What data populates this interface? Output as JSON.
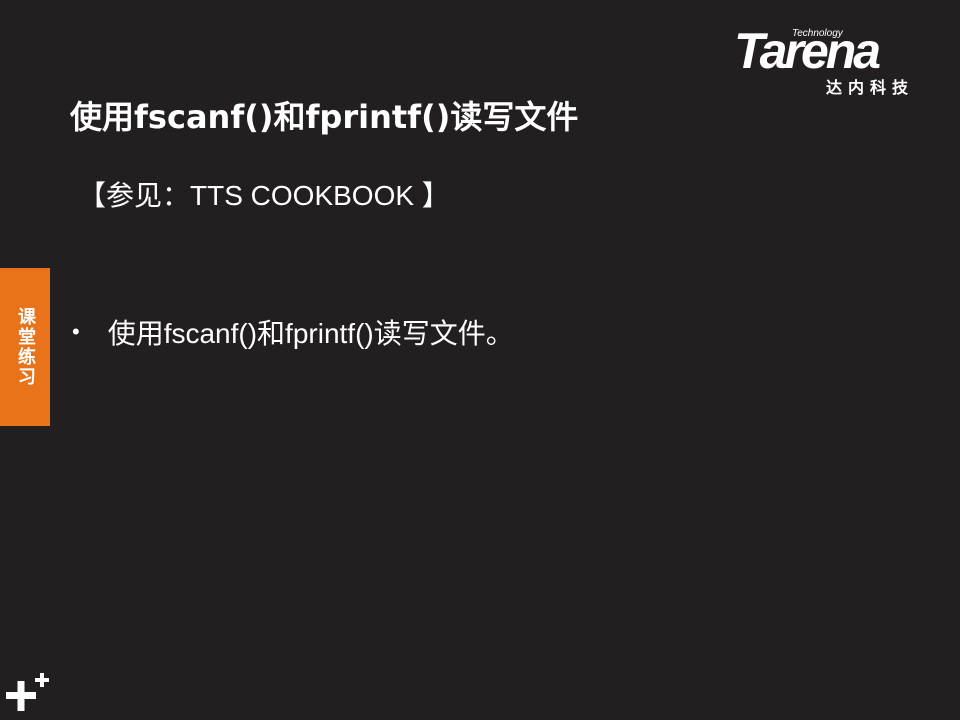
{
  "brand": {
    "technology": "Technology",
    "name": "Tarena",
    "cn_name": "达内科技"
  },
  "slide": {
    "title": "使用fscanf()和fprintf()读写文件",
    "reference": "【参见：TTS COOKBOOK 】",
    "side_tab": "课堂练习",
    "bullets": [
      "使用fscanf()和fprintf()读写文件。"
    ]
  },
  "colors": {
    "background": "#231f20",
    "accent": "#e8731a",
    "text": "#ffffff"
  },
  "icons": {
    "corner": "plus-icon"
  }
}
